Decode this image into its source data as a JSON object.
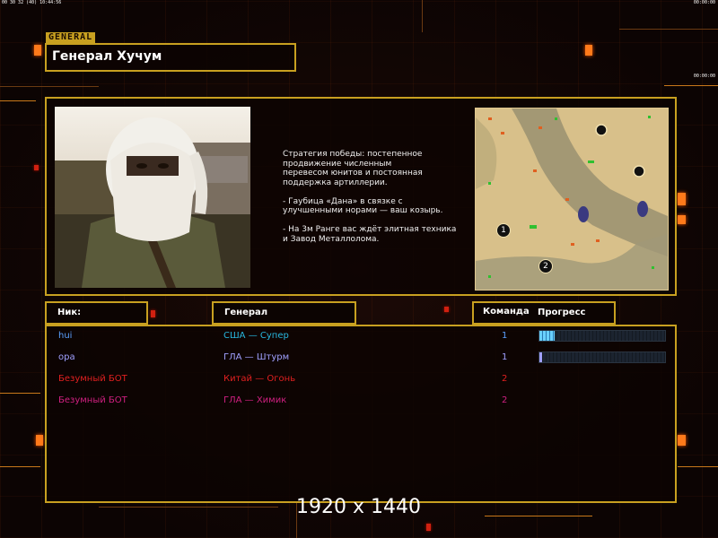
{
  "status_bar": {
    "left": "00 30 32 (40) 10:44:56",
    "right_top": "00:00:00",
    "right_bottom": "00:00:00"
  },
  "general": {
    "tag": "GENERAL",
    "name": "Генерал Хучум",
    "description": "Стратегия победы: постепенное\nпродвижение численным\nперевесом юнитов и постоянная\nподдержка артиллерии.\n\n- Гаубица «Дана» в связке с\nулучшенными норами — ваш козырь.\n\n- На 3м Ранге вас ждёт элитная техника\nи Завод Металлолома."
  },
  "map": {
    "start_markers": [
      "1",
      "2"
    ]
  },
  "table": {
    "headers": {
      "nick": "Ник:",
      "general": "Генерал",
      "team": "Команда",
      "progress": "Прогресс"
    },
    "rows": [
      {
        "nick": "hui",
        "general": "США — Супер",
        "team": "1",
        "color": "#5aa0ff",
        "progress": 0.12
      },
      {
        "nick": "ора",
        "general": "ГЛА — Штурм",
        "team": "1",
        "color": "#a0a0ff",
        "progress": 0.02
      },
      {
        "nick": "Безумный БОТ",
        "general": "Китай — Огонь",
        "team": "2",
        "color": "#e02020",
        "progress": null
      },
      {
        "nick": "Безумный БОТ",
        "general": "ГЛА — Химик",
        "team": "2",
        "color": "#d02080",
        "progress": null
      }
    ]
  },
  "general_colors": [
    "#28b8e0",
    "#a0a0ff",
    "#e02020",
    "#d02080"
  ],
  "overlay": {
    "resolution": "1920 x 1440"
  }
}
